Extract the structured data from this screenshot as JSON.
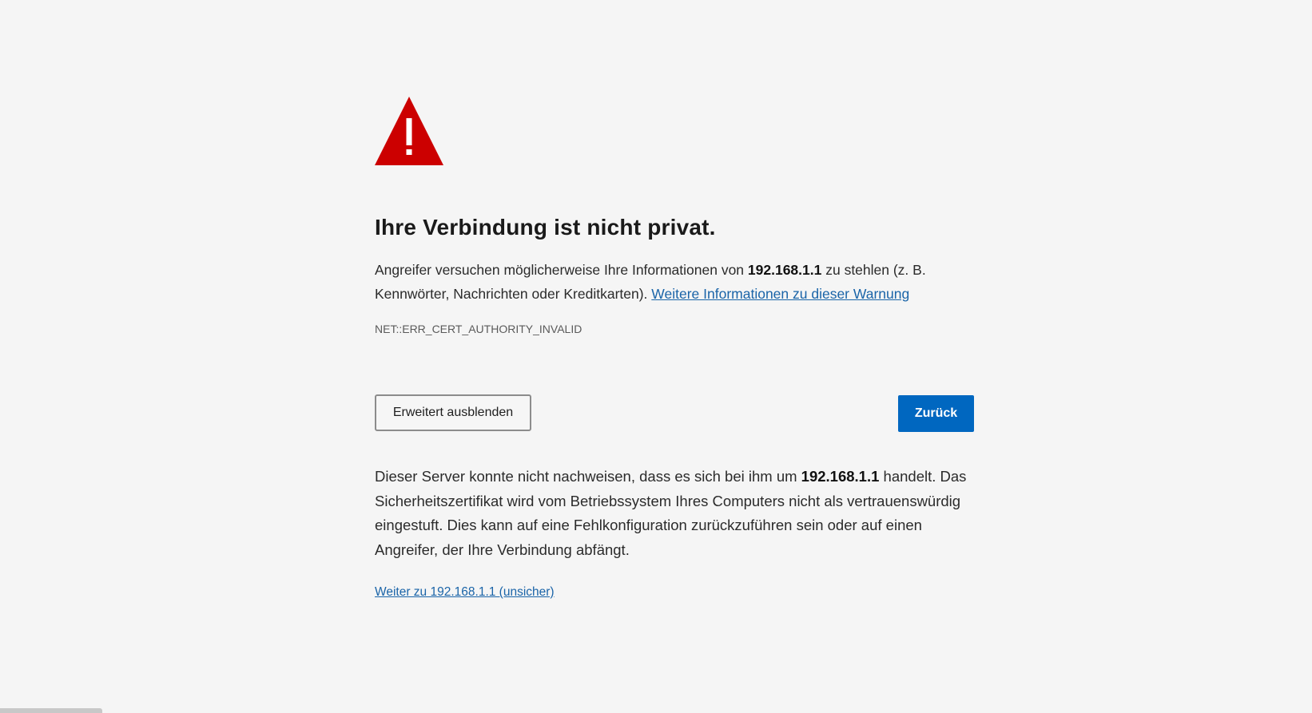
{
  "page": {
    "title": "Ihre Verbindung ist nicht privat.",
    "intro": {
      "before_host": "Angreifer versuchen möglicherweise Ihre Informationen von ",
      "host": "192.168.1.1",
      "after_host": " zu stehlen (z. B. Kennwörter, Nachrichten oder Kreditkarten). ",
      "learn_more_link": "Weitere Informationen zu dieser Warnung"
    },
    "error_code": "NET::ERR_CERT_AUTHORITY_INVALID",
    "buttons": {
      "advanced_label": "Erweitert ausblenden",
      "back_label": "Zurück"
    },
    "details": {
      "before_host": "Dieser Server konnte nicht nachweisen, dass es sich bei ihm um ",
      "host": "192.168.1.1",
      "after_host": " handelt. Das Sicherheitszertifikat wird vom Betriebssystem Ihres Computers nicht als vertrauenswürdig eingestuft. Dies kann auf eine Fehlkonfiguration zurückzuführen sein oder auf einen Angreifer, der Ihre Verbindung abfängt."
    },
    "proceed_link": "Weiter zu 192.168.1.1 (unsicher)"
  },
  "icons": {
    "warning": "warning-triangle-icon"
  },
  "colors": {
    "background": "#f5f5f5",
    "warning_red": "#cc0000",
    "link_blue": "#1a64a8",
    "primary_button": "#0067c0"
  }
}
